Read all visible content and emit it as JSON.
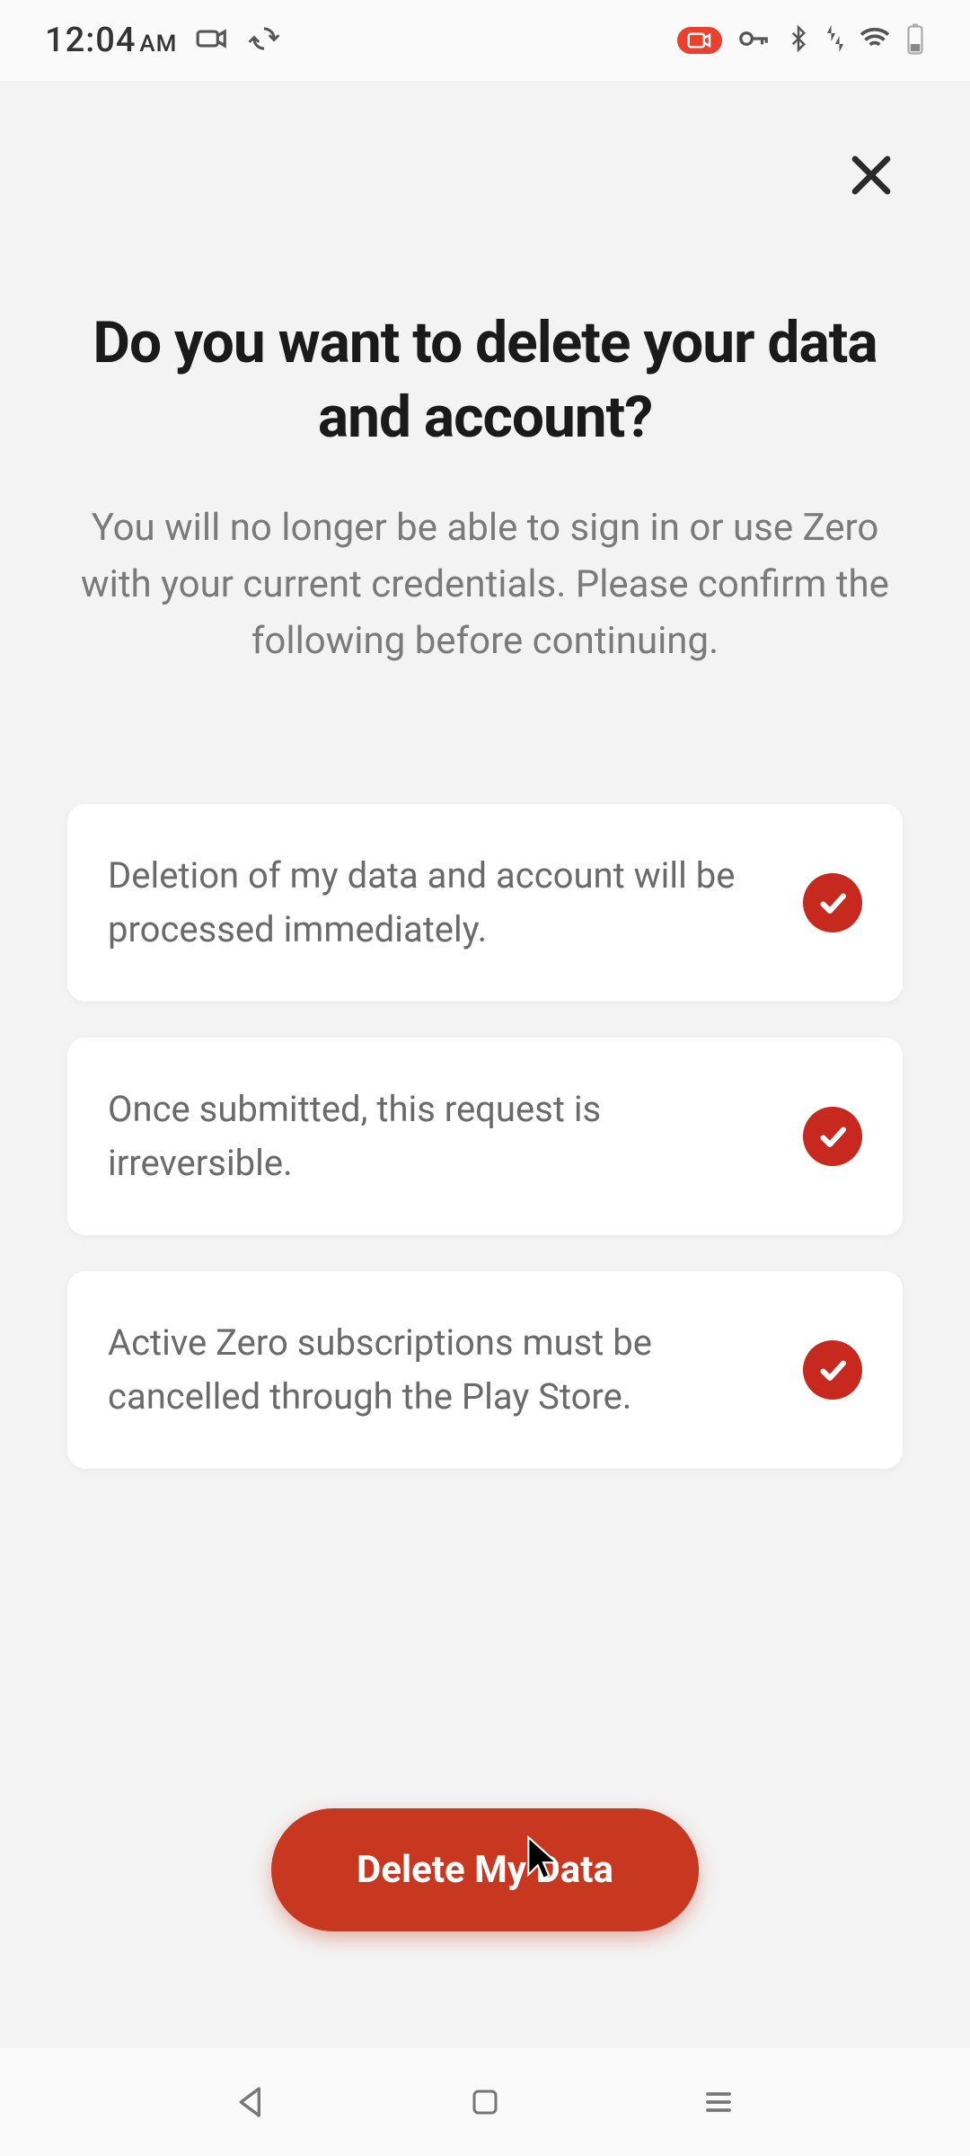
{
  "status_bar": {
    "time": "12:04",
    "ampm": "AM"
  },
  "page": {
    "heading": "Do you want to delete your data and account?",
    "subheading": "You will no longer be able to sign in or use Zero with your current credentials. Please confirm the following before continuing."
  },
  "confirmations": [
    {
      "text": "Deletion of my data and account will be processed immediately.",
      "checked": true
    },
    {
      "text": "Once submitted, this request is irreversible.",
      "checked": true
    },
    {
      "text": "Active Zero subscriptions must be cancelled through the Play Store.",
      "checked": true
    }
  ],
  "actions": {
    "delete_label": "Delete My Data"
  },
  "colors": {
    "accent": "#c8371f",
    "check": "#c8291e"
  }
}
